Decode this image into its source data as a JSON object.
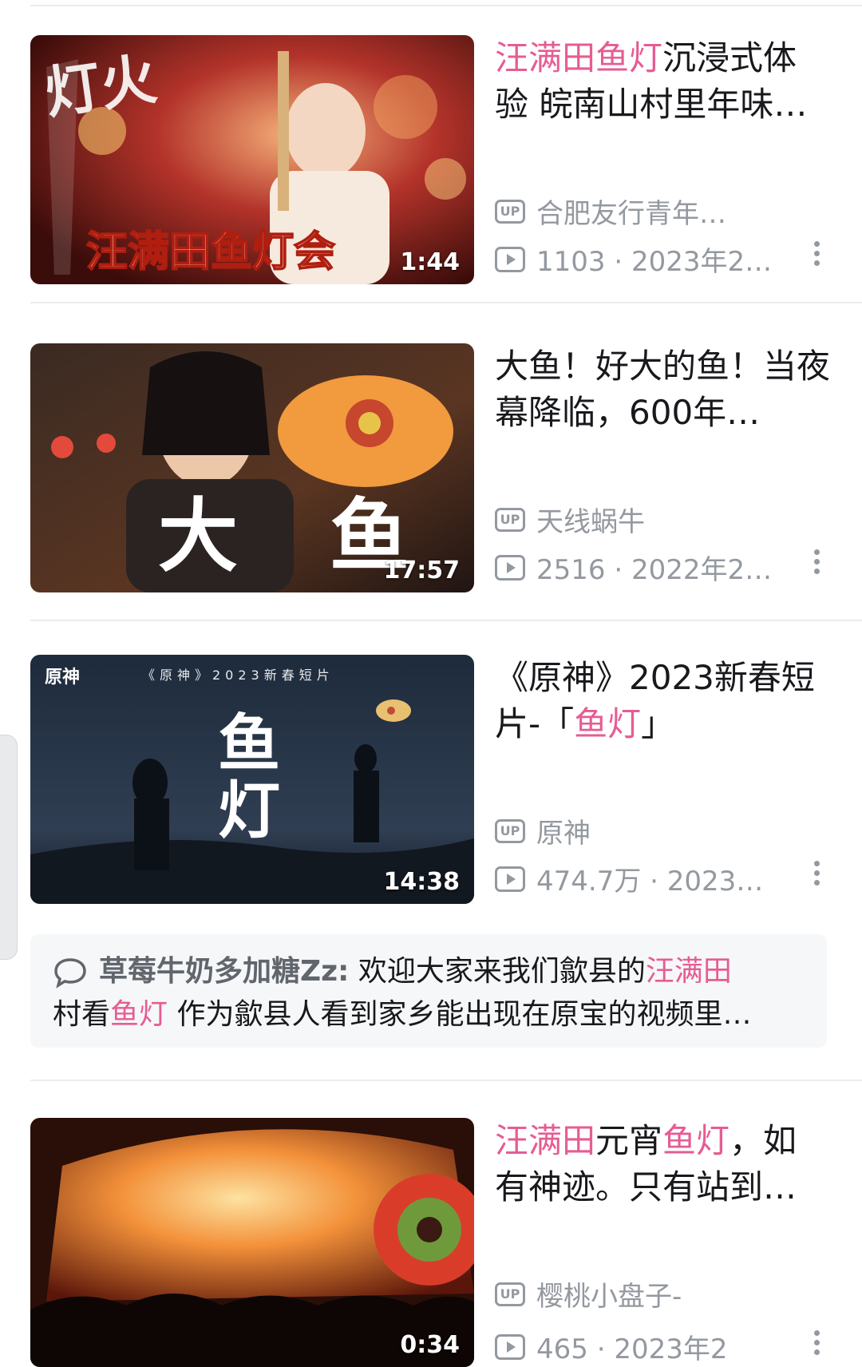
{
  "videos": [
    {
      "title_parts": [
        {
          "text": "汪满田鱼灯",
          "hl": true
        },
        {
          "text": "沉浸式体验 皖南山村里年味…",
          "hl": false
        }
      ],
      "up_name": "合肥友行青年…",
      "stats": "1103 · 2023年2…",
      "duration": "1:44",
      "thumb_text": "汪满田鱼灯会"
    },
    {
      "title_parts": [
        {
          "text": "大鱼！好大的鱼！当夜幕降临，600年…",
          "hl": false
        }
      ],
      "up_name": "天线蜗牛",
      "stats": "2516 · 2022年2…",
      "duration": "17:57",
      "thumb_text": "大 鱼"
    },
    {
      "title_parts": [
        {
          "text": "《原神》2023新春短片-「",
          "hl": false
        },
        {
          "text": "鱼灯",
          "hl": true
        },
        {
          "text": "」",
          "hl": false
        }
      ],
      "up_name": "原神",
      "stats": "474.7万 · 2023…",
      "duration": "14:38",
      "thumb_text": "鱼灯",
      "thumb_header": "《原神》2023新春短片",
      "thumb_logo": "原神"
    },
    {
      "title_parts": [
        {
          "text": "汪满田",
          "hl": true
        },
        {
          "text": "元宵",
          "hl": false
        },
        {
          "text": "鱼灯",
          "hl": true
        },
        {
          "text": "，如有神迹。只有站到…",
          "hl": false
        }
      ],
      "up_name": "樱桃小盘子-",
      "stats": "465 · 2023年2",
      "duration": "0:34"
    }
  ],
  "comment": {
    "user": "草莓牛奶多加糖Zz:",
    "parts": [
      {
        "text": " 欢迎大家来我们歙县的",
        "hl": false
      },
      {
        "text": "汪满田",
        "hl": true
      },
      {
        "text": "村看",
        "hl": false
      },
      {
        "text": "鱼灯",
        "hl": true
      },
      {
        "text": " 作为歙县人看到家乡能出现在原宝的视频里…",
        "hl": false
      }
    ]
  },
  "icons": {
    "up": "up-badge-icon",
    "views": "play-count-icon",
    "more": "more-vertical-icon",
    "comment": "comment-bubble-icon"
  },
  "colors": {
    "highlight": "#e65c93",
    "meta": "#9499a0",
    "text": "#18191c",
    "comment_bg": "#f6f7f8"
  }
}
